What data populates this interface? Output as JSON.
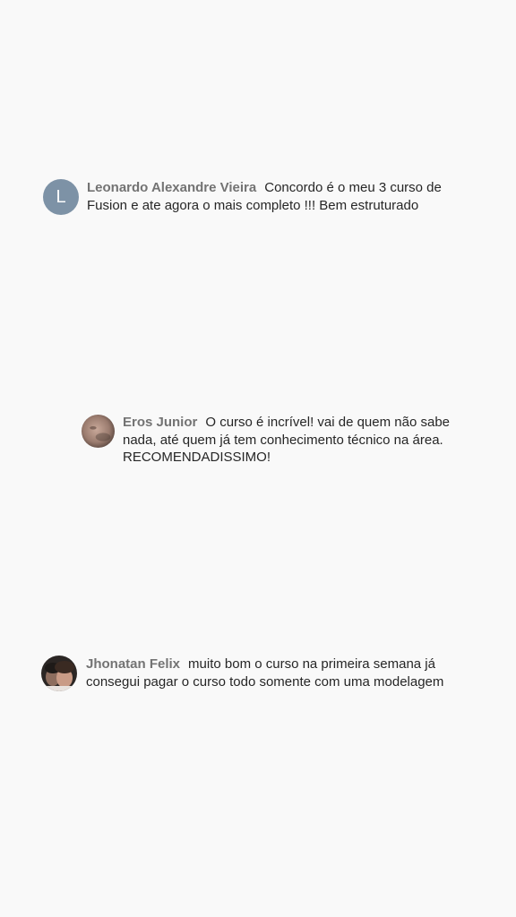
{
  "comments": [
    {
      "avatar_letter": "L",
      "avatar_color": "#7d92a6",
      "author": "Leonardo Alexandre Vieira",
      "text": "Concordo é o meu 3 curso de Fusion e ate agora o mais completo !!! Bem estruturado"
    },
    {
      "avatar_icon": "profile-photo-icon",
      "author": "Eros Junior",
      "text": "O curso é incrível! vai de quem não sabe nada, até quem já tem conhecimento técnico na área. RECOMENDADISSIMO!"
    },
    {
      "avatar_icon": "profile-photo-icon",
      "author": "Jhonatan Felix",
      "text": "muito bom o curso na primeira semana já consegui pagar o curso todo somente com uma modelagem"
    }
  ],
  "colors": {
    "background": "#f9f9f9",
    "author": "#737373",
    "text": "#262626"
  }
}
